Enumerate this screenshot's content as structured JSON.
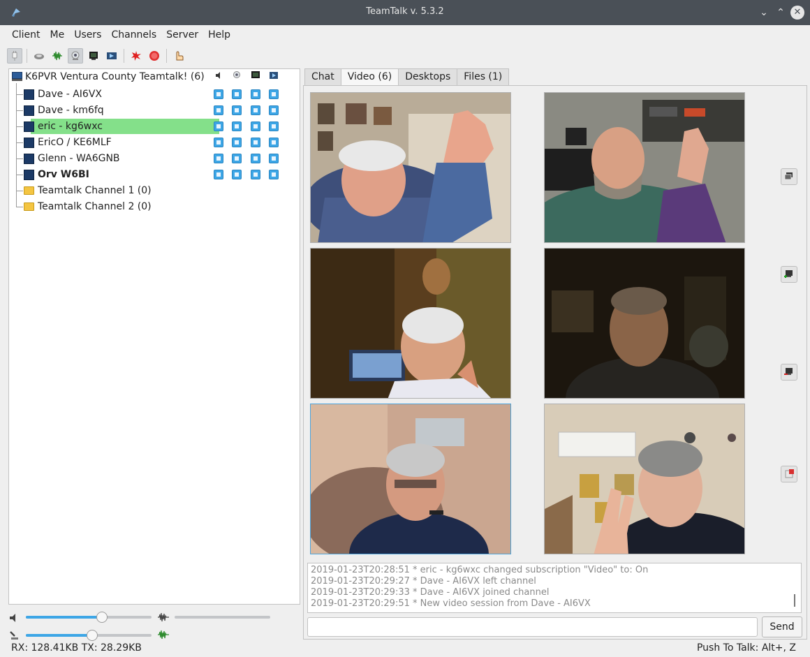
{
  "window": {
    "title": "TeamTalk v. 5.3.2",
    "controls": [
      "minimize-icon",
      "maximize-icon",
      "close-icon"
    ]
  },
  "menu": [
    "Client",
    "Me",
    "Users",
    "Channels",
    "Server",
    "Help"
  ],
  "toolbar": {
    "buttons": [
      {
        "name": "connect",
        "icon": "plug-icon",
        "active": true
      },
      {
        "name": "enable-voice-activation",
        "icon": "speaker-icon",
        "active": false
      },
      {
        "name": "voice-waveform",
        "icon": "waveform-icon",
        "active": false
      },
      {
        "name": "enable-webcam",
        "icon": "webcam-icon",
        "active": true
      },
      {
        "name": "share-desktop",
        "icon": "desktop-icon",
        "active": false
      },
      {
        "name": "stream-media",
        "icon": "media-icon",
        "active": false
      },
      {
        "name": "mute-all",
        "icon": "burst-icon",
        "active": false
      },
      {
        "name": "record",
        "icon": "record-icon",
        "active": false
      },
      {
        "name": "raise-hand",
        "icon": "hand-icon",
        "active": false
      }
    ]
  },
  "tree": {
    "server": "K6PVR Ventura County Teamtalk! (6)",
    "column_icons": [
      "voice-icon",
      "webcam-icon",
      "desktop-icon",
      "media-icon"
    ],
    "users": [
      {
        "name": "Dave - AI6VX",
        "bold": false,
        "selected": false
      },
      {
        "name": "Dave - km6fq",
        "bold": false,
        "selected": false
      },
      {
        "name": "eric - kg6wxc",
        "bold": false,
        "selected": true
      },
      {
        "name": "EricO / KE6MLF",
        "bold": false,
        "selected": false
      },
      {
        "name": "Glenn - WA6GNB",
        "bold": false,
        "selected": false
      },
      {
        "name": "Orv W6BI",
        "bold": true,
        "selected": false
      }
    ],
    "channels": [
      "Teamtalk Channel 1 (0)",
      "Teamtalk Channel 2 (0)"
    ]
  },
  "volume": {
    "master_level": 0.62,
    "mic_level": 0.52
  },
  "tabs": [
    {
      "label": "Chat",
      "selected": false
    },
    {
      "label": "Video (6)",
      "selected": true
    },
    {
      "label": "Desktops",
      "selected": false
    },
    {
      "label": "Files (1)",
      "selected": false
    }
  ],
  "videos": [
    "video-1",
    "video-2",
    "video-3",
    "video-4",
    "video-5",
    "video-6"
  ],
  "side_buttons": [
    "detach-video-icon",
    "add-video-icon",
    "remove-video-icon",
    "close-video-icon"
  ],
  "log": [
    "2019-01-23T20:28:51  * eric - kg6wxc changed subscription \"Video\" to: On",
    "2019-01-23T20:29:27  * Dave - AI6VX left channel",
    "2019-01-23T20:29:33  * Dave - AI6VX joined channel",
    "2019-01-23T20:29:51  * New video session from Dave - AI6VX"
  ],
  "message_input": {
    "value": "",
    "placeholder": ""
  },
  "send_label": "Send",
  "status": {
    "left": "RX: 128.41KB TX: 28.29KB",
    "right": "Push To Talk: Alt+, Z"
  }
}
